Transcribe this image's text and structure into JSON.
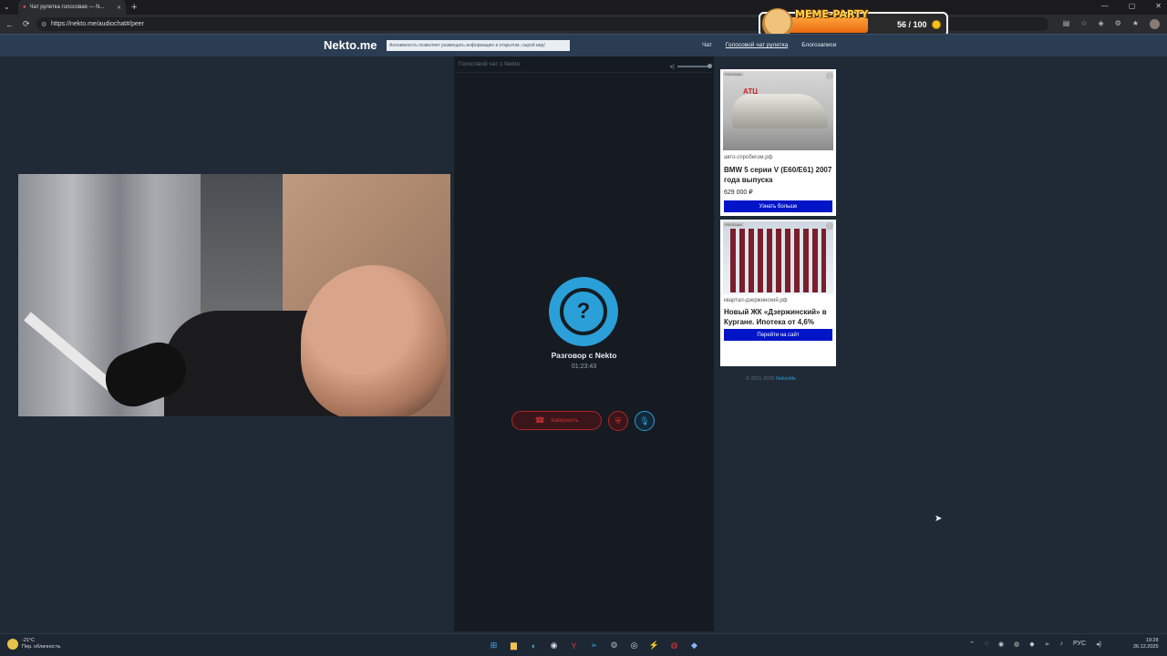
{
  "browser": {
    "tab_title": "Чат рулетка голосовая — N...",
    "url": "https://nekto.me/audiochat#/peer"
  },
  "overlay": {
    "title": "MEME-PARTY",
    "count": "56 / 100"
  },
  "site": {
    "logo": "Nekto.me",
    "notice": "Анонимность позволяет размещать информацию в открытом, сырой вид!",
    "nav": [
      "Чат",
      "Голосовой чат рулетка",
      "Блогозаписи"
    ]
  },
  "chat": {
    "header": "Голосовой чат с Nekto",
    "title": "Разговор с Nekto",
    "timer": "01:23:43",
    "end_label": "Завершить",
    "question_mark": "?"
  },
  "ads": [
    {
      "label": "РЕКЛАМА",
      "img_text": "АТЦ",
      "source": "авто-спробегом.рф",
      "headline": "BMW 5 серии V (E60/E61) 2007 года выпуска",
      "price": "629 000 ₽",
      "cta": "Узнать больше"
    },
    {
      "label": "РЕКЛАМА",
      "source": "квартал-дзержинский.рф",
      "headline": "Новый ЖК «Дзержинский» в Кургане. Ипотека от 4,6%",
      "cta": "Перейти на сайт"
    }
  ],
  "footer": {
    "copy": "© 2011-2025",
    "link": "NektoMe"
  },
  "taskbar": {
    "temp": "-21°C",
    "weather": "Пер. облачность",
    "lang": "РУС",
    "time": "19:28",
    "date": "26.12.2025"
  },
  "colors": {
    "accent": "#2a9fd8",
    "danger": "#b0262c",
    "header_bg": "#2b3d52",
    "ad_cta": "#0015c8"
  }
}
